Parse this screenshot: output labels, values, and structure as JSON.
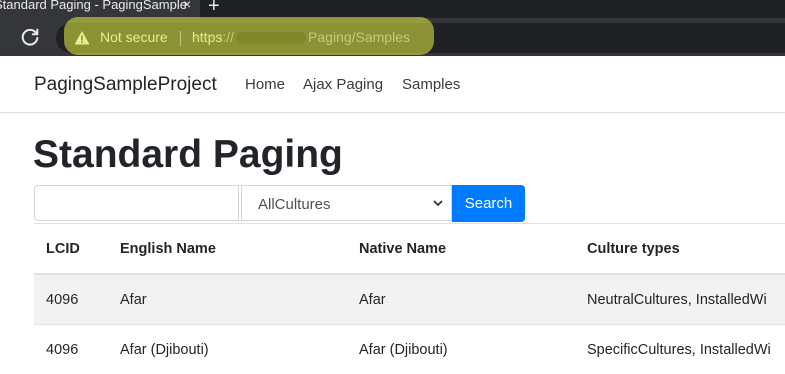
{
  "browser": {
    "tab_title": "Standard Paging - PagingSample",
    "new_tab_label": "+",
    "security_label": "Not secure",
    "url_scheme": "https",
    "url_sep": "://",
    "url_path": "Paging/Samples"
  },
  "navbar": {
    "brand": "PagingSampleProject",
    "links": [
      "Home",
      "Ajax Paging",
      "Samples"
    ]
  },
  "page": {
    "title": "Standard Paging",
    "search_value": "",
    "culture_select": "AllCultures",
    "search_button": "Search"
  },
  "table": {
    "headers": [
      "LCID",
      "English Name",
      "Native Name",
      "Culture types"
    ],
    "rows": [
      [
        "4096",
        "Afar",
        "Afar",
        "NeutralCultures, InstalledWi"
      ],
      [
        "4096",
        "Afar (Djibouti)",
        "Afar (Djibouti)",
        "SpecificCultures, InstalledWi"
      ]
    ]
  },
  "colors": {
    "primary": "#007bff",
    "chrome_dark": "#202124",
    "highlight": "#e4f046"
  }
}
